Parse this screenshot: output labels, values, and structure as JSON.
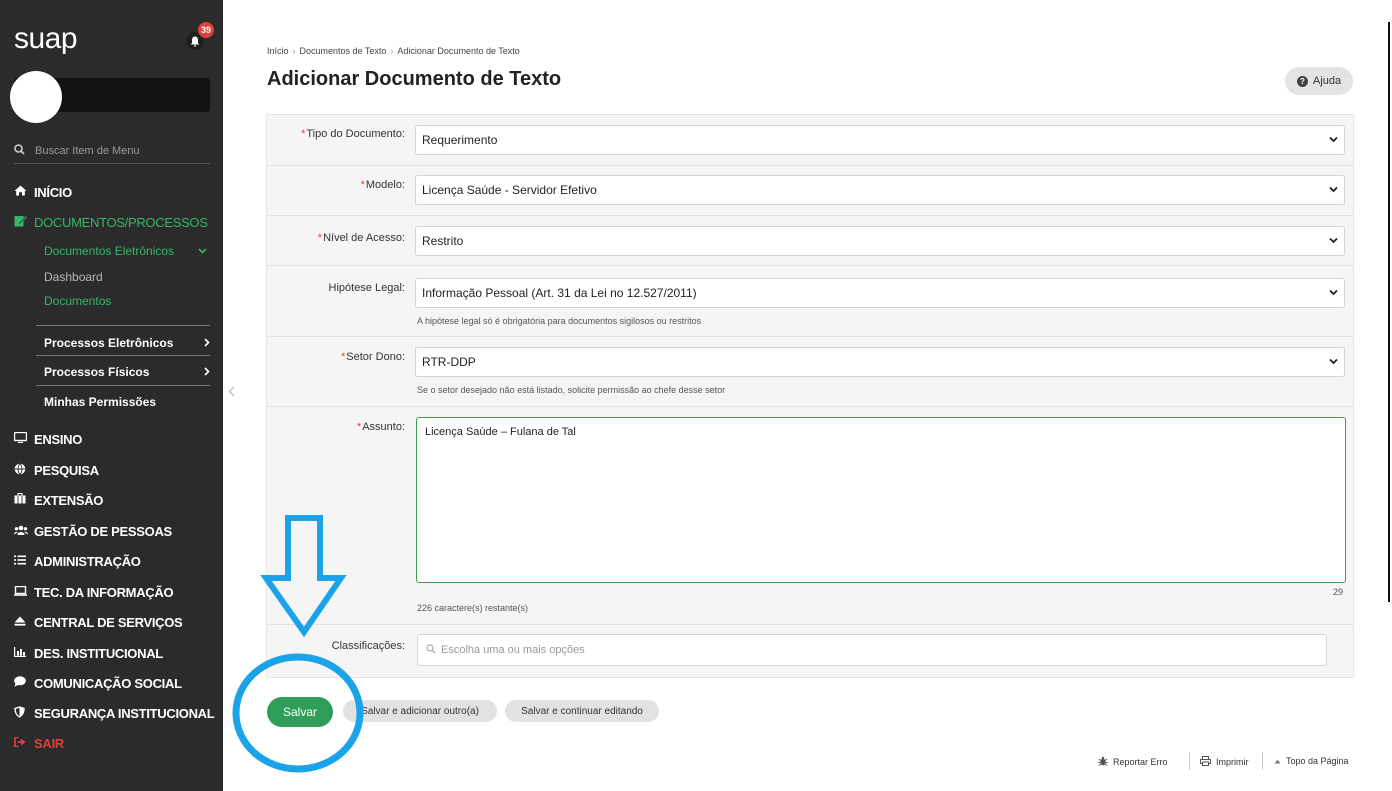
{
  "sidebar": {
    "logo": "suap",
    "notification_count": "39",
    "search_placeholder": "Buscar Item de Menu",
    "menu": {
      "inicio": "INÍCIO",
      "documentos": "DOCUMENTOS/PROCESSOS",
      "documentos_eletronicos": "Documentos Eletrônicos",
      "dashboard": "Dashboard",
      "documentos_sub": "Documentos",
      "processos_eletronicos": "Processos Eletrônicos",
      "processos_fisicos": "Processos Físicos",
      "minhas_permissoes": "Minhas Permissões",
      "ensino": "ENSINO",
      "pesquisa": "PESQUISA",
      "extensao": "EXTENSÃO",
      "gestao": "GESTÃO DE PESSOAS",
      "administracao": "ADMINISTRAÇÃO",
      "tec": "TEC. DA INFORMAÇÃO",
      "central": "CENTRAL DE SERVIÇOS",
      "des": "DES. INSTITUCIONAL",
      "comunicacao": "COMUNICAÇÃO SOCIAL",
      "seguranca": "SEGURANÇA INSTITUCIONAL",
      "sair": "SAIR"
    }
  },
  "breadcrumb": {
    "items": [
      "Início",
      "Documentos de Texto",
      "Adicionar Documento de Texto"
    ]
  },
  "page": {
    "title": "Adicionar Documento de Texto",
    "help": "Ajuda"
  },
  "form": {
    "tipo_label": "Tipo do Documento:",
    "tipo_value": "Requerimento",
    "modelo_label": "Modelo:",
    "modelo_value": "Licença Saúde - Servidor Efetivo",
    "nivel_label": "Nível de Acesso:",
    "nivel_value": "Restrito",
    "hipotese_label": "Hipótese Legal:",
    "hipotese_value": "Informação Pessoal (Art. 31 da Lei no 12.527/2011)",
    "hipotese_help": "A hipótese legal só é obrigatória para documentos sigilosos ou restritos",
    "setor_label": "Setor Dono:",
    "setor_value": "RTR-DDP",
    "setor_help": "Se o setor desejado não está listado, solicite permissão ao chefe desse setor",
    "assunto_label": "Assunto:",
    "assunto_value": "Licença Saúde – Fulana de Tal",
    "assunto_count": "29",
    "assunto_remaining": "226 caractere(s) restante(s)",
    "classificacoes_label": "Classificações:",
    "classificacoes_placeholder": "Escolha uma ou mais opções"
  },
  "buttons": {
    "save": "Salvar",
    "save_add": "Salvar e adicionar outro(a)",
    "save_continue": "Salvar e continuar editando"
  },
  "footer": {
    "report": "Reportar Erro",
    "print": "Imprimir",
    "top": "Topo da Página"
  },
  "colors": {
    "sidebar_bg": "#2b2b2b",
    "accent_green": "#35b66b",
    "save_green": "#2f9e58",
    "danger": "#e0403a",
    "annotation_blue": "#1aa3e8"
  }
}
